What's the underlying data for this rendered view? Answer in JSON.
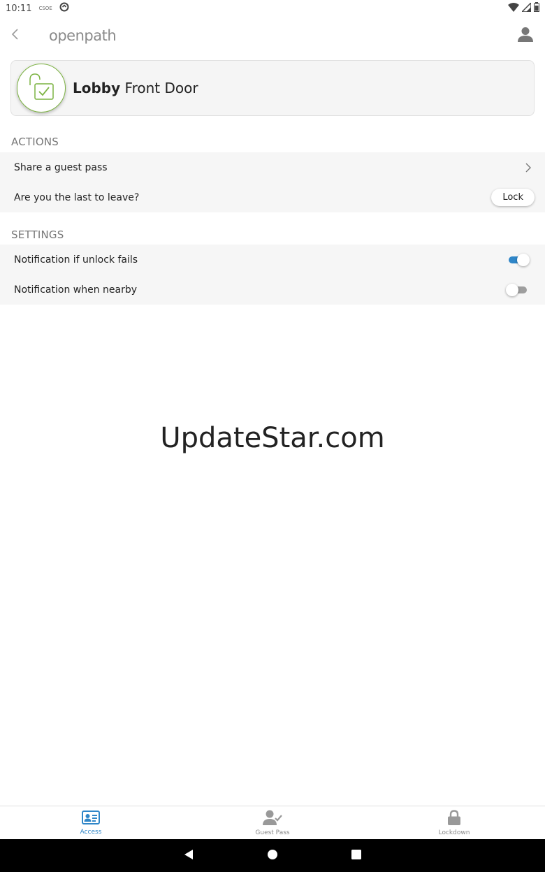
{
  "status_bar": {
    "time": "10:11",
    "small_icon_text": "CSOE"
  },
  "header": {
    "brand": "openpath"
  },
  "entry": {
    "name_bold": "Lobby",
    "name_rest": " Front Door"
  },
  "actions": {
    "header": "ACTIONS",
    "items": [
      {
        "label": "Share a guest pass"
      },
      {
        "label": "Are you the last to leave?",
        "button": "Lock"
      }
    ]
  },
  "settings": {
    "header": "SETTINGS",
    "items": [
      {
        "label": "Notification if unlock fails",
        "enabled": true
      },
      {
        "label": "Notification when nearby",
        "enabled": false
      }
    ]
  },
  "watermark": "UpdateStar.com",
  "bottom_nav": {
    "items": [
      {
        "label": "Access",
        "icon": "id-card-icon",
        "active": true
      },
      {
        "label": "Guest Pass",
        "icon": "user-check-icon",
        "active": false
      },
      {
        "label": "Lockdown",
        "icon": "lock-icon",
        "active": false
      }
    ]
  },
  "colors": {
    "accent": "#2f86c8",
    "unlocked_green": "#7cb342",
    "list_bg": "#f6f6f6"
  }
}
